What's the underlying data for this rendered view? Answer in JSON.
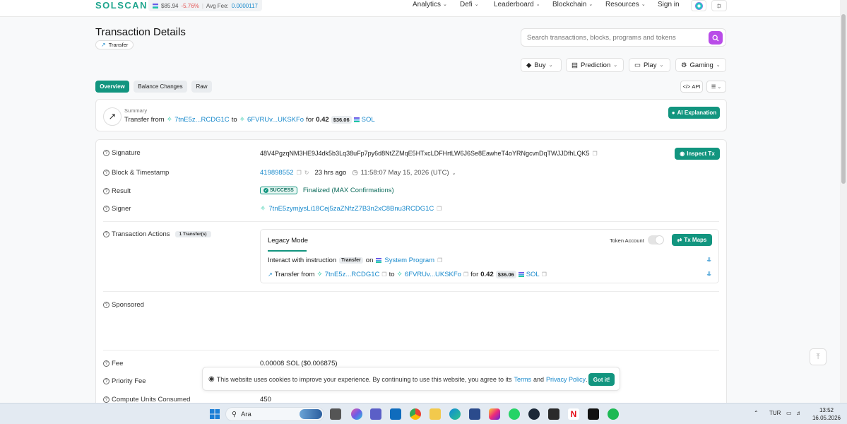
{
  "header": {
    "logo": "SOLSCAN",
    "sol_price": "$85.94",
    "sol_change": "-5.76%",
    "avg_fee_label": "Avg Fee:",
    "avg_fee_value": "0.0000117",
    "nav": [
      "Analytics",
      "Defi",
      "Leaderboard",
      "Blockchain",
      "Resources"
    ],
    "sign_in": "Sign in"
  },
  "page": {
    "title": "Transaction Details",
    "type_badge": "Transfer",
    "search_placeholder": "Search transactions, blocks, programs and tokens",
    "buttons": [
      "Buy",
      "Prediction",
      "Play",
      "Gaming"
    ]
  },
  "tabs": {
    "items": [
      "Overview",
      "Balance Changes",
      "Raw"
    ],
    "active": "Overview",
    "api": "API"
  },
  "summary": {
    "label": "Summary",
    "transfer_from": "Transfer from",
    "from_addr": "7tnE5z...RCDG1C",
    "to": "to",
    "to_addr": "6FVRUv...UKSKFo",
    "for": "for",
    "amount": "0.42",
    "usd": "$36.06",
    "token": "SOL",
    "ai_button": "AI Explanation"
  },
  "details": {
    "signature_label": "Signature",
    "signature": "48V4PgzqNM3HE9J4dk5b3Lq38uFp7py6d8NtZZMqE5HTxcLDFHrtLW6J6Se8EawheT4oYRNgcvnDqTWJJDfhLQK5",
    "inspect_button": "Inspect Tx",
    "block_label": "Block & Timestamp",
    "block": "419898552",
    "ago": "23 hrs ago",
    "timestamp": "11:58:07 May 15, 2026 (UTC)",
    "result_label": "Result",
    "result_status": "SUCCESS",
    "result_text": "Finalized (MAX Confirmations)",
    "signer_label": "Signer",
    "signer": "7tnE5zymjysLi18Cej5zaZNfzZ7B3n2xC8Bnu3RCDG1C",
    "actions_label": "Transaction Actions",
    "actions_count": "1 Transfer(s)",
    "legacy_mode": "Legacy Mode",
    "token_account": "Token Account",
    "tx_maps": "Tx Maps",
    "interact_text": "Interact with instruction",
    "instruction": "Transfer",
    "on": "on",
    "program": "System Program",
    "sponsored_label": "Sponsored",
    "fee_label": "Fee",
    "fee": "0.00008 SOL ($0.006875)",
    "priority_label": "Priority Fee",
    "compute_label": "Compute Units Consumed",
    "compute": "450"
  },
  "cookie": {
    "text": "This website uses cookies to improve your experience. By continuing to use this website, you agree to its",
    "terms": "Terms",
    "and": "and",
    "privacy": "Privacy Policy",
    "period": ".",
    "button": "Got it!"
  },
  "taskbar": {
    "search": "Ara",
    "lang": "TUR",
    "time": "13:52",
    "date": "16.05.2026"
  },
  "colors": {
    "brand": "#12957f",
    "link": "#1a8acc",
    "negative": "#e55353",
    "search_button": "#b94ce8"
  }
}
